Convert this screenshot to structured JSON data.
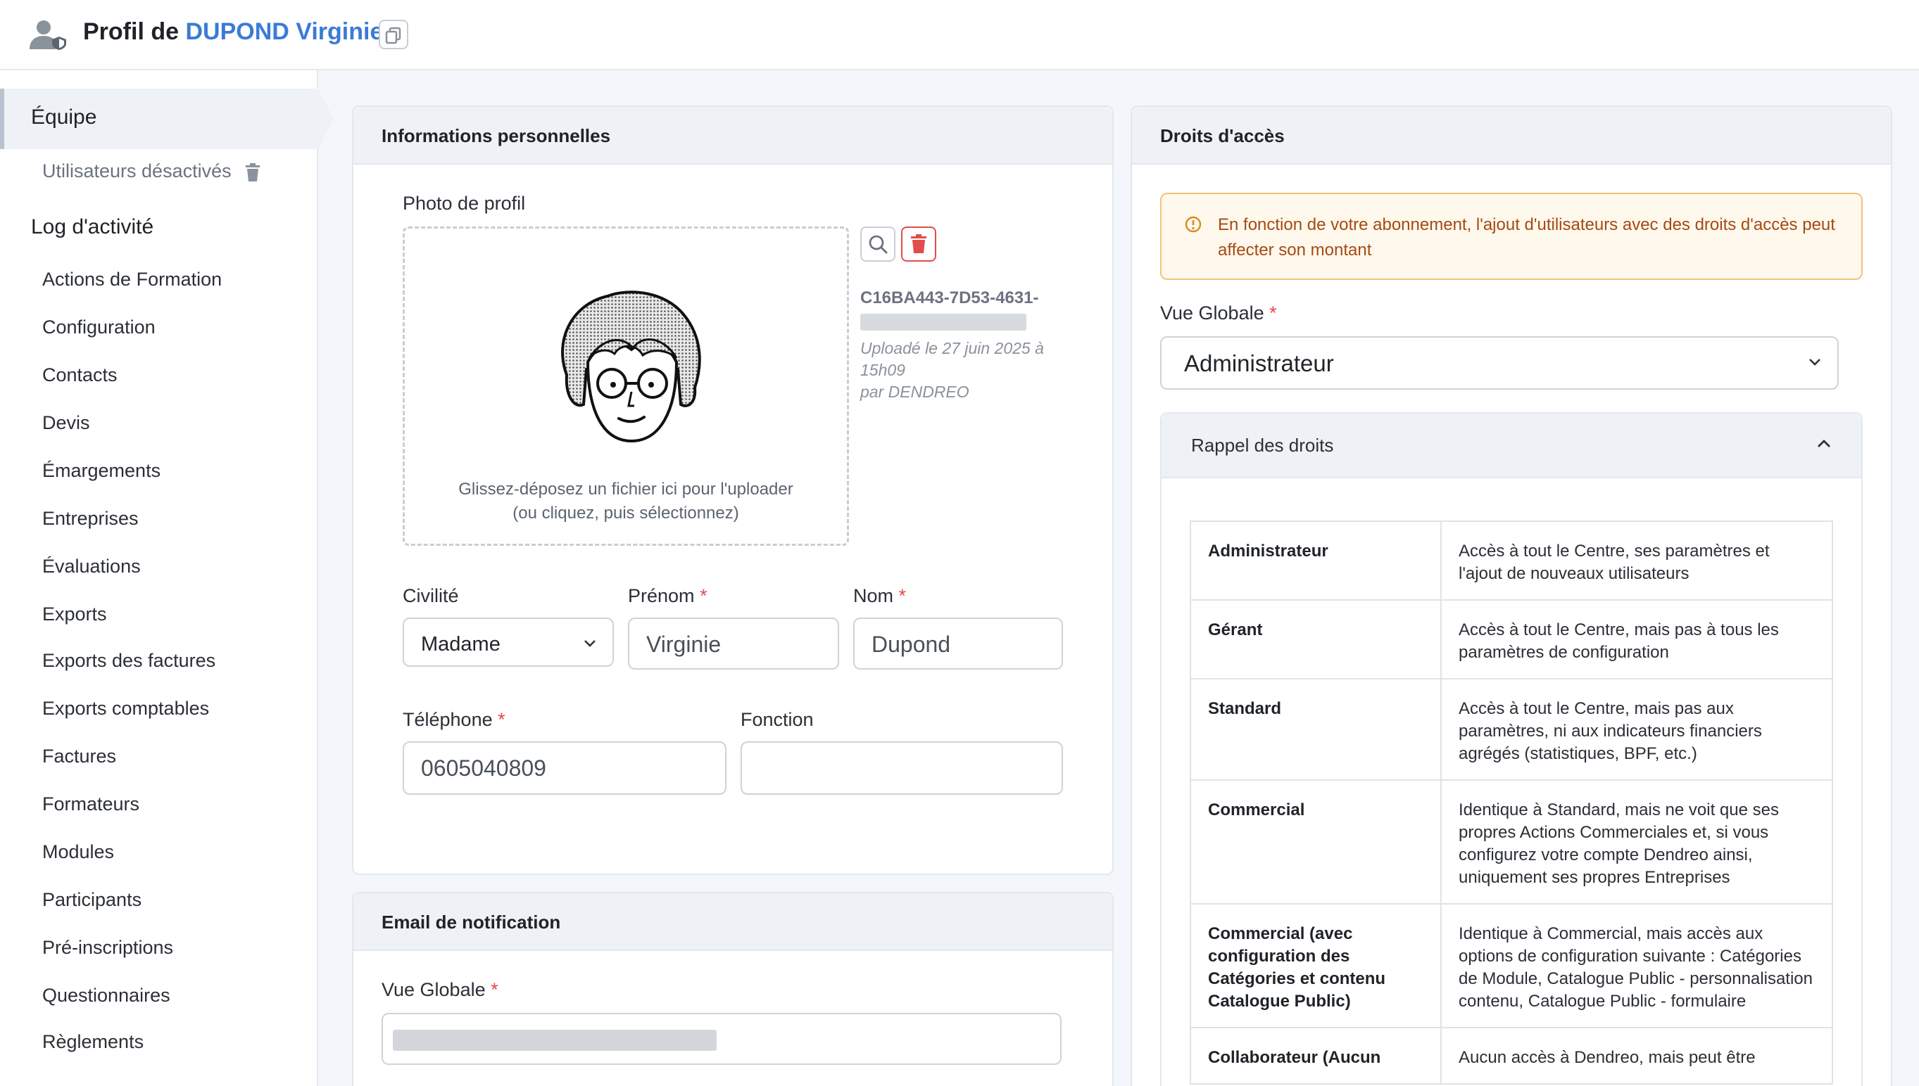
{
  "header": {
    "title_prefix": "Profil de",
    "title_name": "DUPOND Virginie",
    "icons": {
      "user": "user-shield-icon",
      "copy": "copy-icon"
    }
  },
  "sidebar": {
    "active": "Équipe",
    "disabled_users": "Utilisateurs désactivés",
    "log_heading": "Log d'activité",
    "items": [
      "Actions de Formation",
      "Configuration",
      "Contacts",
      "Devis",
      "Émargements",
      "Entreprises",
      "Évaluations",
      "Exports",
      "Exports des factures",
      "Exports comptables",
      "Factures",
      "Formateurs",
      "Modules",
      "Participants",
      "Pré-inscriptions",
      "Questionnaires",
      "Règlements"
    ]
  },
  "personal": {
    "title": "Informations personnelles",
    "photo_label": "Photo de profil",
    "drop_line1": "Glissez-déposez un fichier ici pour l'uploader",
    "drop_line2": "(ou cliquez, puis sélectionnez)",
    "file_id": "C16BA443-7D53-4631-",
    "upload_date": "Uploadé le 27 juin 2025 à 15h09",
    "upload_by": "par DENDREO",
    "civilite_label": "Civilité",
    "civilite_value": "Madame",
    "prenom_label": "Prénom",
    "prenom_value": "Virginie",
    "nom_label": "Nom",
    "nom_value": "Dupond",
    "telephone_label": "Téléphone",
    "telephone_value": "0605040809",
    "fonction_label": "Fonction",
    "fonction_value": "",
    "required_mark": "*"
  },
  "notification": {
    "title": "Email de notification",
    "vue_label": "Vue Globale"
  },
  "access": {
    "title": "Droits d'accès",
    "alert": "En fonction de votre abonnement, l'ajout d'utilisateurs avec des droits d'accès peut affecter son montant",
    "vue_label": "Vue Globale",
    "vue_value": "Administrateur",
    "rappel_title": "Rappel des droits",
    "rights": [
      {
        "role": "Administrateur",
        "desc": "Accès à tout le Centre, ses paramètres et l'ajout de nouveaux utilisateurs"
      },
      {
        "role": "Gérant",
        "desc": "Accès à tout le Centre, mais pas à tous les paramètres de configuration"
      },
      {
        "role": "Standard",
        "desc": "Accès à tout le Centre, mais pas aux paramètres, ni aux indicateurs financiers agrégés (statistiques, BPF, etc.)"
      },
      {
        "role": "Commercial",
        "desc": "Identique à Standard, mais ne voit que ses propres Actions Commerciales et, si vous configurez votre compte Dendreo ainsi, uniquement ses propres Entreprises"
      },
      {
        "role": "Commercial (avec configuration des Catégories et contenu Catalogue Public)",
        "desc": "Identique à Commercial, mais accès aux options de configuration suivante : Catégories de Module, Catalogue Public - personnalisation contenu, Catalogue Public - formulaire"
      },
      {
        "role": "Collaborateur (Aucun",
        "desc": "Aucun accès à Dendreo, mais peut être"
      }
    ]
  },
  "colors": {
    "accent": "#3a7bd5",
    "danger": "#e24c4b",
    "alert_text": "#a44a14",
    "alert_bg": "#fff8ec"
  }
}
